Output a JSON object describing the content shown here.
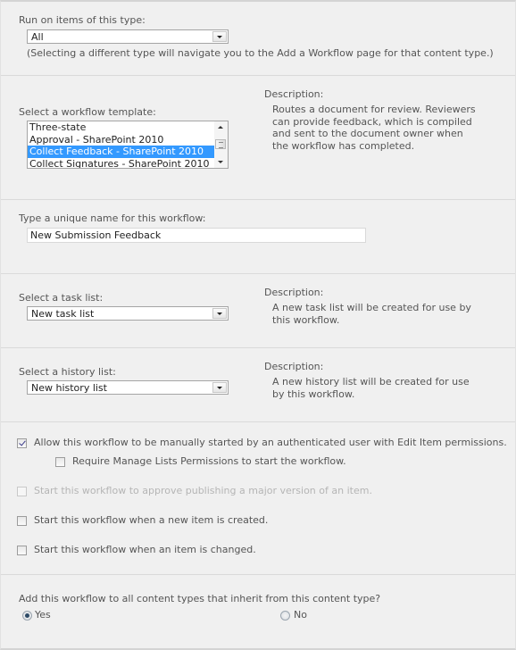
{
  "content_type": {
    "label": "Run on items of this type:",
    "selected": "All",
    "note": "(Selecting a different type will navigate you to the Add a Workflow page for that content type.)"
  },
  "template": {
    "label": "Select a workflow template:",
    "options": [
      {
        "label": "Three-state",
        "selected": false
      },
      {
        "label": "Approval - SharePoint 2010",
        "selected": false
      },
      {
        "label": "Collect Feedback - SharePoint 2010",
        "selected": true
      },
      {
        "label": "Collect Signatures - SharePoint 2010",
        "selected": false
      }
    ],
    "description_title": "Description:",
    "description": "Routes a document for review. Reviewers can provide feedback, which is compiled and sent to the document owner when the workflow has completed."
  },
  "name": {
    "label": "Type a unique name for this workflow:",
    "value": "New Submission Feedback"
  },
  "task_list": {
    "label": "Select a task list:",
    "selected": "New task list",
    "description_title": "Description:",
    "description": "A new task list will be created for use by this workflow."
  },
  "history_list": {
    "label": "Select a history list:",
    "selected": "New history list",
    "description_title": "Description:",
    "description": "A new history list will be created for use by this workflow."
  },
  "start_options": {
    "manual": {
      "label": "Allow this workflow to be manually started by an authenticated user with Edit Item permissions.",
      "checked": true
    },
    "require_manage": {
      "label": "Require Manage Lists Permissions to start the workflow.",
      "checked": false
    },
    "publish_major": {
      "label": "Start this workflow to approve publishing a major version of an item.",
      "checked": false,
      "disabled": true
    },
    "on_create": {
      "label": "Start this workflow when a new item is created.",
      "checked": false
    },
    "on_change": {
      "label": "Start this workflow when an item is changed.",
      "checked": false
    }
  },
  "inherit": {
    "question": "Add this workflow to all content types that inherit from this content type?",
    "yes_label": "Yes",
    "no_label": "No",
    "selected": "Yes"
  }
}
